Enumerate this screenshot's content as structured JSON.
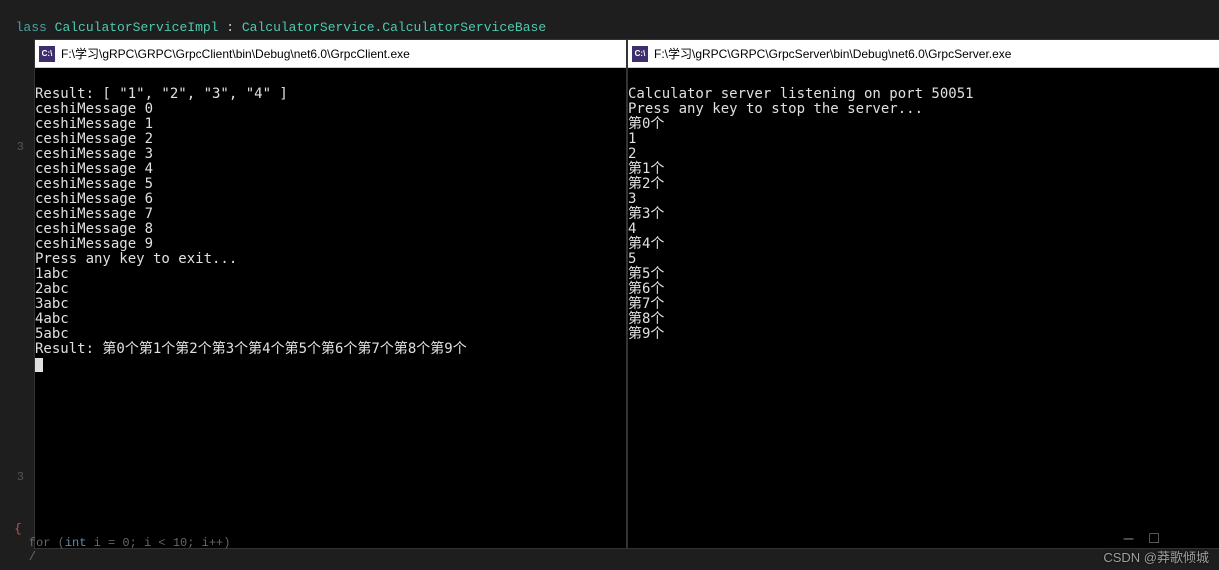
{
  "code_header": {
    "keyword": "lass",
    "class_name": "CalculatorServiceImpl",
    "sep": " : ",
    "base_class": "CalculatorService.CalculatorServiceBase"
  },
  "left_window": {
    "title": "F:\\学习\\gRPC\\GRPC\\GrpcClient\\bin\\Debug\\net6.0\\GrpcClient.exe",
    "icon_text": "C:\\",
    "lines": [
      "Result: [ \"1\", \"2\", \"3\", \"4\" ]",
      "ceshiMessage 0",
      "ceshiMessage 1",
      "ceshiMessage 2",
      "ceshiMessage 3",
      "ceshiMessage 4",
      "ceshiMessage 5",
      "ceshiMessage 6",
      "ceshiMessage 7",
      "ceshiMessage 8",
      "ceshiMessage 9",
      "Press any key to exit...",
      "1abc",
      "2abc",
      "3abc",
      "4abc",
      "5abc",
      "Result: 第0个第1个第2个第3个第4个第5个第6个第7个第8个第9个"
    ]
  },
  "right_window": {
    "title": "F:\\学习\\gRPC\\GRPC\\GrpcServer\\bin\\Debug\\net6.0\\GrpcServer.exe",
    "icon_text": "C:\\",
    "lines": [
      "Calculator server listening on port 50051",
      "Press any key to stop the server...",
      "第0个",
      "1",
      "2",
      "第1个",
      "第2个",
      "3",
      "第3个",
      "4",
      "第4个",
      "5",
      "第5个",
      "第6个",
      "第7个",
      "第8个",
      "第9个"
    ]
  },
  "gutter": {
    "num3_top": "3",
    "num3_bottom": "3"
  },
  "code_footer": {
    "brace_open": "{",
    "brace_close": "}",
    "for_line_pre": "    for ",
    "for_line_paren": "(",
    "for_line_type": "int ",
    "for_line_body": "i = 0; i < 10; i++",
    "for_line_close": ")",
    "slash": "    /"
  },
  "watermark": "CSDN @莽歌倾城",
  "win_controls": {
    "minimize": "—",
    "box": "□"
  }
}
